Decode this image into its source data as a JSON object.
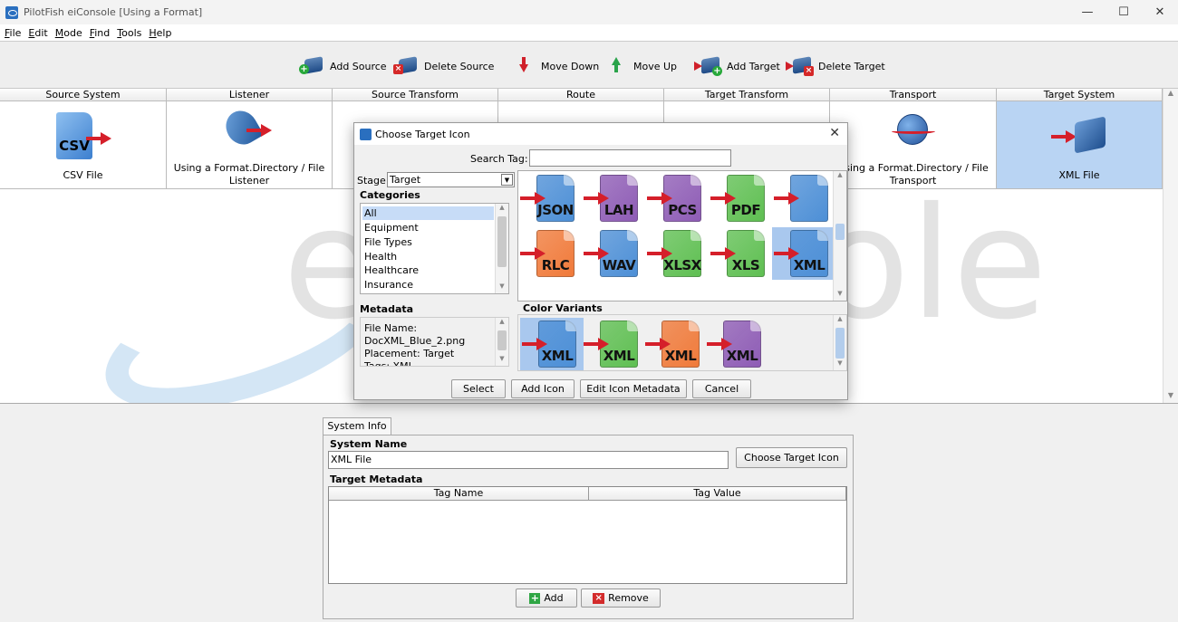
{
  "window": {
    "title": "PilotFish eiConsole [Using a Format]"
  },
  "window_controls": {
    "minimize": "—",
    "maximize": "☐",
    "close": "✕"
  },
  "menu": [
    "File",
    "Edit",
    "Mode",
    "Find",
    "Tools",
    "Help"
  ],
  "toolbar": {
    "add_source": "Add Source",
    "delete_source": "Delete Source",
    "move_down": "Move Down",
    "move_up": "Move Up",
    "add_target": "Add Target",
    "delete_target": "Delete Target"
  },
  "stages": {
    "headers": [
      "Source System",
      "Listener",
      "Source Transform",
      "Route",
      "Target Transform",
      "Transport",
      "Target System"
    ],
    "source_system_label": "CSV File",
    "source_system_icon_text": "CSV",
    "listener_label": "Using a Format.Directory / File Listener",
    "transport_label": "Using a Format.Directory / File Transport",
    "target_system_label": "XML File",
    "watermark_left": "e",
    "watermark_right": "ole"
  },
  "bottom": {
    "tab": "System Info",
    "system_name_title": "System Name",
    "system_name_value": "XML File",
    "choose_icon_button": "Choose Target Icon",
    "metadata_title": "Target Metadata",
    "col_tag_name": "Tag Name",
    "col_tag_value": "Tag Value",
    "add_button": "Add",
    "remove_button": "Remove"
  },
  "dialog": {
    "title": "Choose Target Icon",
    "close": "✕",
    "search_label": "Search Tag:",
    "search_value": "",
    "stage_label": "Stage:",
    "stage_value": "Target",
    "categories_title": "Categories",
    "categories": [
      "All",
      "Equipment",
      "File Types",
      "Health",
      "Healthcare",
      "Insurance"
    ],
    "metadata_title": "Metadata",
    "metadata_lines": [
      "File Name:",
      "DocXML_Blue_2.png",
      "Placement: Target",
      "Tags: XML"
    ],
    "icons_row1": [
      {
        "text": "JSON",
        "color": "#4d8fd6"
      },
      {
        "text": "LAH",
        "color": "#8e5cb5"
      },
      {
        "text": "PCS",
        "color": "#8e5cb5"
      },
      {
        "text": "PDF",
        "color": "#5fbf52"
      },
      {
        "text": "",
        "color": "#4d8fd6"
      }
    ],
    "icons_row2": [
      {
        "text": "RLC",
        "color": "#f07a3a"
      },
      {
        "text": "WAV",
        "color": "#4d8fd6"
      },
      {
        "text": "XLSX",
        "color": "#5fbf52"
      },
      {
        "text": "XLS",
        "color": "#5fbf52"
      },
      {
        "text": "XML",
        "color": "#4d8fd6"
      }
    ],
    "color_variants_title": "Color Variants",
    "variants": [
      {
        "text": "XML",
        "color": "#4d8fd6"
      },
      {
        "text": "XML",
        "color": "#5fbf52"
      },
      {
        "text": "XML",
        "color": "#f07a3a"
      },
      {
        "text": "XML",
        "color": "#8e5cb5"
      }
    ],
    "buttons": {
      "select": "Select",
      "add_icon": "Add Icon",
      "edit_metadata": "Edit Icon Metadata",
      "cancel": "Cancel"
    }
  }
}
